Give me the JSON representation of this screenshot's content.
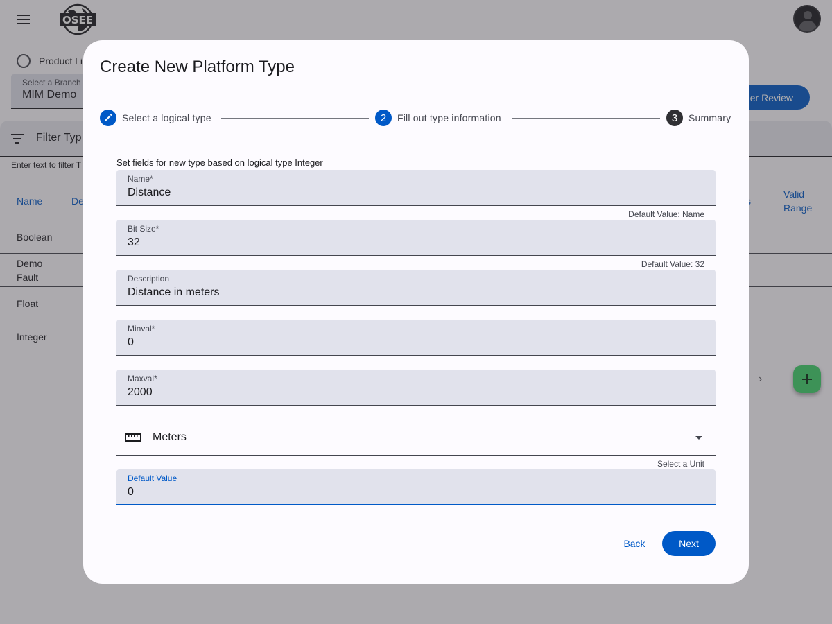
{
  "app": {
    "logo_text": "OSEE",
    "product_line_label": "Product Line",
    "branch_select": {
      "label": "Select a Branch",
      "value": "MIM Demo"
    },
    "review_button": "Commit Manager Review",
    "review_button_visible": "er Review",
    "filter": {
      "label": "Filter Types",
      "label_visible": "Filter Typ",
      "hint": "Enter text to filter Types",
      "hint_visible": "Enter text to filter T"
    },
    "table": {
      "headers": {
        "name": "Name",
        "description_partial": "De",
        "units_partial": "s",
        "valid_range_line1": "Valid",
        "valid_range_line2": "Range"
      },
      "rows": [
        {
          "name_line1": "Boolean",
          "name_line2": ""
        },
        {
          "name_line1": "Demo",
          "name_line2": "Fault"
        },
        {
          "name_line1": "Float",
          "name_line2": ""
        },
        {
          "name_line1": "Integer",
          "name_line2": ""
        }
      ]
    },
    "paginator_next": "›",
    "fab_label": "+"
  },
  "dialog": {
    "title": "Create New Platform Type",
    "steps": [
      {
        "label": "Select a logical type",
        "state": "edit",
        "icon": "pencil-icon"
      },
      {
        "label": "Fill out type information",
        "state": "active",
        "number": "2"
      },
      {
        "label": "Summary",
        "state": "inactive",
        "number": "3"
      }
    ],
    "intro": "Set fields for new type based on logical type Integer",
    "fields": {
      "name": {
        "label": "Name*",
        "value": "Distance",
        "hint": "Default Value: Name"
      },
      "bit_size": {
        "label": "Bit Size*",
        "value": "32",
        "hint": "Default Value: 32"
      },
      "description": {
        "label": "Description",
        "value": "Distance in meters"
      },
      "minval": {
        "label": "Minval*",
        "value": "0"
      },
      "maxval": {
        "label": "Maxval*",
        "value": "2000"
      },
      "unit": {
        "value": "Meters",
        "hint": "Select a Unit",
        "icon": "ruler-icon"
      },
      "default_value": {
        "label": "Default Value",
        "value": "0"
      }
    },
    "buttons": {
      "back": "Back",
      "next": "Next"
    }
  },
  "colors": {
    "primary": "#0059c7",
    "fab": "#3ed36a",
    "field_bg": "#e1e2ec",
    "dialog_bg": "#fdfbff"
  }
}
